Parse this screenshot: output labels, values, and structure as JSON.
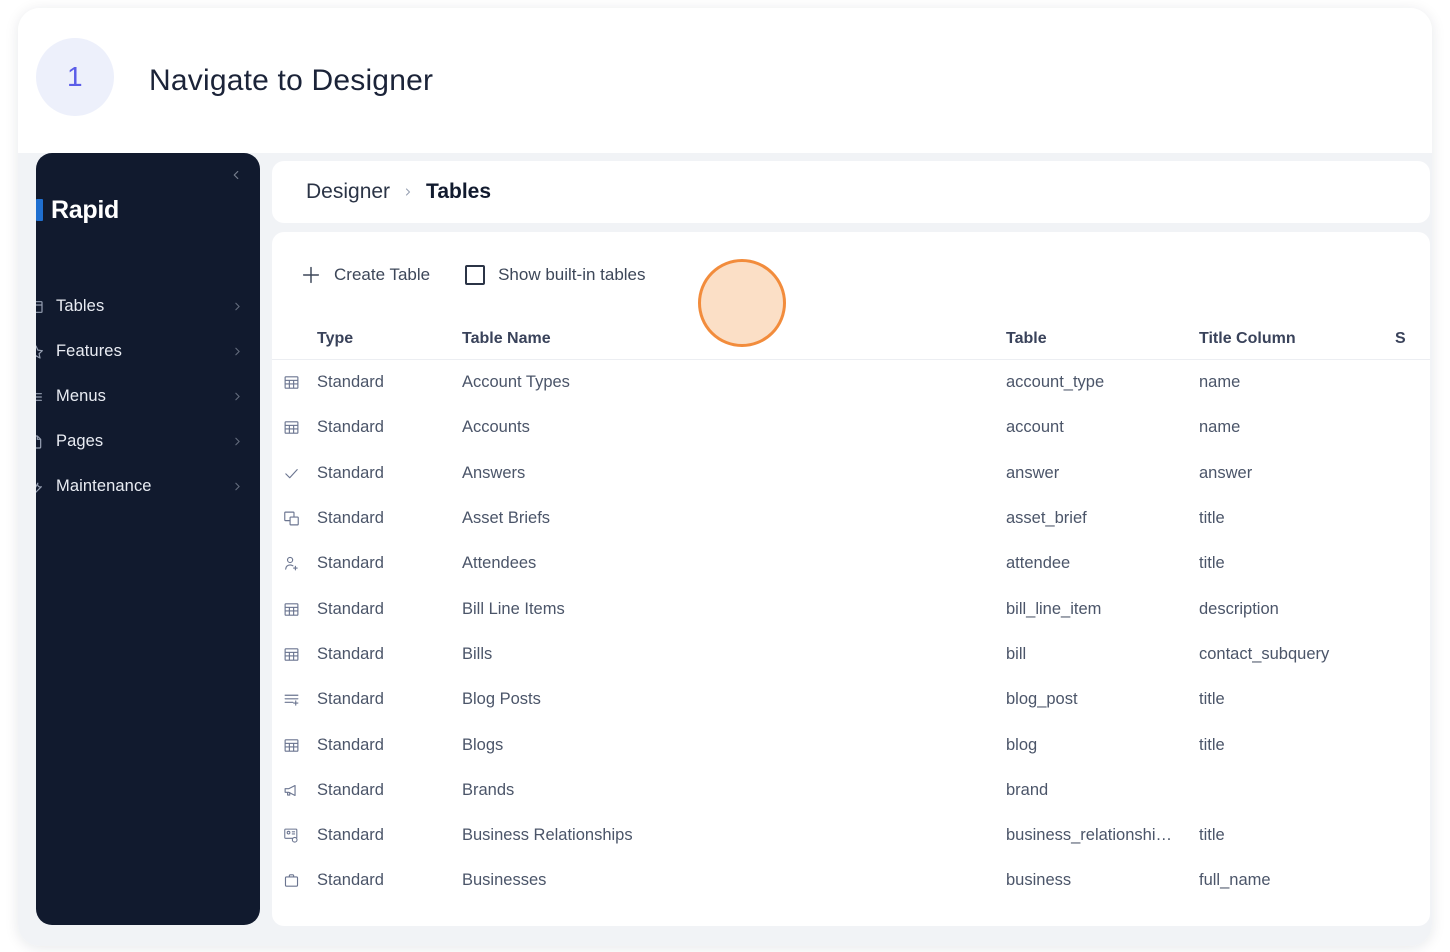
{
  "step": {
    "number": "1",
    "title": "Navigate to Designer",
    "badge_bg": "#edf0fb",
    "badge_color": "#5b5de8"
  },
  "sidebar": {
    "logo": "Rapid",
    "logo_mark_color": "#1f6fd0",
    "collapse_icon": "chevron-left-icon",
    "background": "#111a2e",
    "items": [
      {
        "label": "Tables",
        "icon": "table-icon",
        "chevron": "chevron-right-icon"
      },
      {
        "label": "Features",
        "icon": "star-icon",
        "chevron": "chevron-right-icon"
      },
      {
        "label": "Menus",
        "icon": "menu-icon",
        "chevron": "chevron-right-icon"
      },
      {
        "label": "Pages",
        "icon": "page-icon",
        "chevron": "chevron-right-icon"
      },
      {
        "label": "Maintenance",
        "icon": "wrench-icon",
        "chevron": "chevron-right-icon"
      }
    ]
  },
  "breadcrumb": {
    "parent": "Designer",
    "separator": "›",
    "current": "Tables"
  },
  "toolbar": {
    "create_table_label": "Create Table",
    "create_table_icon": "plus-icon",
    "show_builtin_label": "Show built-in tables",
    "show_builtin_checked": false
  },
  "table": {
    "columns": [
      {
        "key": "icon",
        "label": ""
      },
      {
        "key": "type",
        "label": "Type"
      },
      {
        "key": "name",
        "label": "Table Name"
      },
      {
        "key": "table",
        "label": "Table"
      },
      {
        "key": "title",
        "label": "Title Column"
      },
      {
        "key": "sec",
        "label": "S"
      }
    ],
    "rows": [
      {
        "icon": "grid-table-icon",
        "type": "Standard",
        "name": "Account Types",
        "table": "account_type",
        "title": "name"
      },
      {
        "icon": "grid-table-icon",
        "type": "Standard",
        "name": "Accounts",
        "table": "account",
        "title": "name"
      },
      {
        "icon": "check-icon",
        "type": "Standard",
        "name": "Answers",
        "table": "answer",
        "title": "answer"
      },
      {
        "icon": "layers-image-icon",
        "type": "Standard",
        "name": "Asset Briefs",
        "table": "asset_brief",
        "title": "title"
      },
      {
        "icon": "person-add-icon",
        "type": "Standard",
        "name": "Attendees",
        "table": "attendee",
        "title": "title"
      },
      {
        "icon": "grid-table-icon",
        "type": "Standard",
        "name": "Bill Line Items",
        "table": "bill_line_item",
        "title": "description"
      },
      {
        "icon": "grid-table-icon",
        "type": "Standard",
        "name": "Bills",
        "table": "bill",
        "title": "contact_subquery"
      },
      {
        "icon": "list-add-icon",
        "type": "Standard",
        "name": "Blog Posts",
        "table": "blog_post",
        "title": "title"
      },
      {
        "icon": "grid-table-icon",
        "type": "Standard",
        "name": "Blogs",
        "table": "blog",
        "title": "title"
      },
      {
        "icon": "megaphone-icon",
        "type": "Standard",
        "name": "Brands",
        "table": "brand",
        "title": ""
      },
      {
        "icon": "contact-card-icon",
        "type": "Standard",
        "name": "Business Relationships",
        "table": "business_relationshi…",
        "title": "title"
      },
      {
        "icon": "briefcase-icon",
        "type": "Standard",
        "name": "Businesses",
        "table": "business",
        "title": "full_name"
      }
    ]
  },
  "annotation": {
    "type": "highlight-circle",
    "fill": "#fbdfc6",
    "border": "#f28c3c"
  }
}
